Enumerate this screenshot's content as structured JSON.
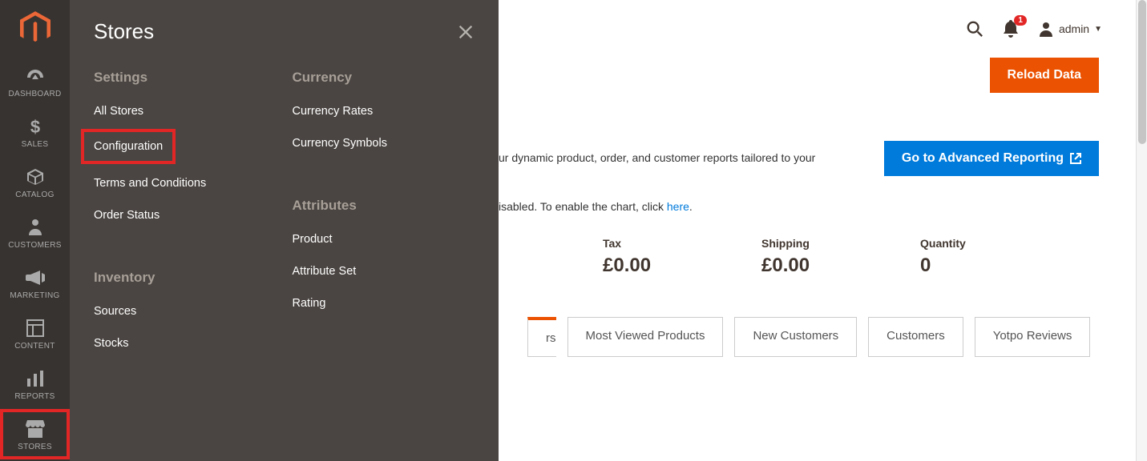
{
  "sidebar": {
    "items": [
      {
        "label": "DASHBOARD",
        "icon": "gauge"
      },
      {
        "label": "SALES",
        "icon": "dollar"
      },
      {
        "label": "CATALOG",
        "icon": "box"
      },
      {
        "label": "CUSTOMERS",
        "icon": "person"
      },
      {
        "label": "MARKETING",
        "icon": "bullhorn"
      },
      {
        "label": "CONTENT",
        "icon": "layout"
      },
      {
        "label": "REPORTS",
        "icon": "bars"
      },
      {
        "label": "STORES",
        "icon": "storefront"
      }
    ]
  },
  "flyout": {
    "title": "Stores",
    "columns": [
      {
        "groups": [
          {
            "heading": "Settings",
            "items": [
              "All Stores",
              "Configuration",
              "Terms and Conditions",
              "Order Status"
            ]
          },
          {
            "heading": "Inventory",
            "items": [
              "Sources",
              "Stocks"
            ]
          }
        ]
      },
      {
        "groups": [
          {
            "heading": "Currency",
            "items": [
              "Currency Rates",
              "Currency Symbols"
            ]
          },
          {
            "heading": "Attributes",
            "items": [
              "Product",
              "Attribute Set",
              "Rating"
            ]
          }
        ]
      }
    ]
  },
  "topbar": {
    "badge_count": "1",
    "username": "admin"
  },
  "buttons": {
    "reload": "Reload Data",
    "advanced": "Go to Advanced Reporting"
  },
  "advanced_text": "ur dynamic product, order, and customer reports tailored to your",
  "chart_note_prefix": "isabled. To enable the chart, click ",
  "chart_note_link": "here",
  "chart_note_suffix": ".",
  "metrics": [
    {
      "label": "Tax",
      "value": "£0.00"
    },
    {
      "label": "Shipping",
      "value": "£0.00"
    },
    {
      "label": "Quantity",
      "value": "0"
    }
  ],
  "tabs": [
    {
      "label": "rs",
      "active": true
    },
    {
      "label": "Most Viewed Products"
    },
    {
      "label": "New Customers"
    },
    {
      "label": "Customers"
    },
    {
      "label": "Yotpo Reviews"
    }
  ]
}
